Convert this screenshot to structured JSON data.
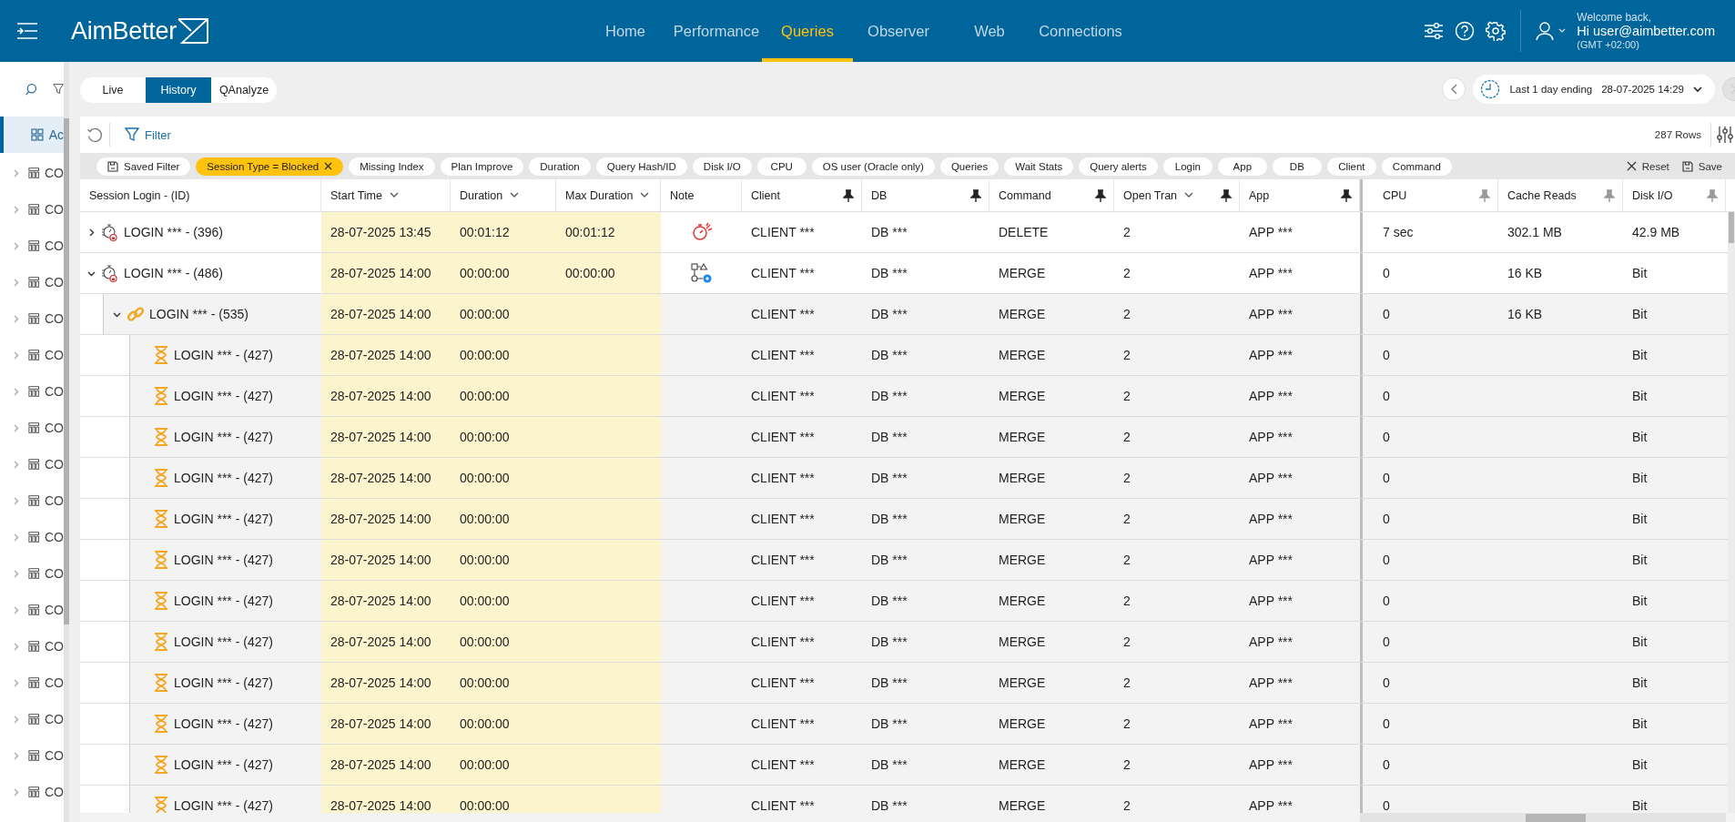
{
  "header": {
    "logo": "AimBetter",
    "nav": [
      {
        "label": "Home",
        "selected": false
      },
      {
        "label": "Performance",
        "selected": false
      },
      {
        "label": "Queries",
        "selected": true
      },
      {
        "label": "Observer",
        "selected": false
      },
      {
        "label": "Web",
        "selected": false
      },
      {
        "label": "Connections",
        "selected": false
      }
    ],
    "user": {
      "greeting": "Welcome back,",
      "name": "Hi user@aimbetter.com",
      "timezone": "(GMT +02:00)"
    }
  },
  "sidebar": {
    "items": [
      {
        "label": "Ac",
        "kind": "dashboard",
        "selected": true
      },
      {
        "label": "CO",
        "kind": "table",
        "selected": false,
        "expanded": false
      },
      {
        "label": "CO",
        "kind": "table",
        "selected": false,
        "expanded": false
      },
      {
        "label": "CO",
        "kind": "table",
        "selected": false,
        "expanded": false
      },
      {
        "label": "CO",
        "kind": "table",
        "selected": false,
        "expanded": false
      },
      {
        "label": "CO",
        "kind": "table",
        "selected": false,
        "expanded": false
      },
      {
        "label": "CO",
        "kind": "table",
        "selected": false,
        "expanded": false
      },
      {
        "label": "CO",
        "kind": "table",
        "selected": false,
        "expanded": false
      },
      {
        "label": "CO",
        "kind": "table",
        "selected": false,
        "expanded": false
      },
      {
        "label": "CO",
        "kind": "table",
        "selected": false,
        "expanded": false
      },
      {
        "label": "CO",
        "kind": "table",
        "selected": false,
        "expanded": false
      },
      {
        "label": "CO",
        "kind": "table",
        "selected": false,
        "expanded": false
      },
      {
        "label": "CO",
        "kind": "table",
        "selected": false,
        "expanded": false
      },
      {
        "label": "CO",
        "kind": "table",
        "selected": false,
        "expanded": false
      },
      {
        "label": "CO",
        "kind": "table",
        "selected": false,
        "expanded": false
      },
      {
        "label": "CO",
        "kind": "table",
        "selected": false,
        "expanded": false
      },
      {
        "label": "CO",
        "kind": "table",
        "selected": false,
        "expanded": false
      },
      {
        "label": "CO",
        "kind": "table",
        "selected": false,
        "expanded": false
      },
      {
        "label": "CO",
        "kind": "table",
        "selected": false,
        "expanded": false
      }
    ]
  },
  "mode_tabs": [
    {
      "label": "Live",
      "selected": false
    },
    {
      "label": "History",
      "selected": true
    },
    {
      "label": "QAnalyze",
      "selected": false
    }
  ],
  "time_range": {
    "label": "Last 1 day ending",
    "value": "28-07-2025 14:29",
    "next_disabled": true
  },
  "toolbar": {
    "filter": "Filter",
    "row_count": "287 Rows"
  },
  "chips": [
    {
      "label": "Saved Filter",
      "kind": "saved"
    },
    {
      "label": "Session Type = Blocked",
      "kind": "active"
    },
    {
      "label": "Missing Index",
      "kind": "plain"
    },
    {
      "label": "Plan Improve",
      "kind": "plain"
    },
    {
      "label": "Duration",
      "kind": "plain"
    },
    {
      "label": "Query Hash/ID",
      "kind": "plain"
    },
    {
      "label": "Disk I/O",
      "kind": "plain"
    },
    {
      "label": "CPU",
      "kind": "plain"
    },
    {
      "label": "OS user (Oracle only)",
      "kind": "plain"
    },
    {
      "label": "Queries",
      "kind": "plain"
    },
    {
      "label": "Wait Stats",
      "kind": "plain"
    },
    {
      "label": "Query alerts",
      "kind": "plain"
    },
    {
      "label": "Login",
      "kind": "plain"
    },
    {
      "label": "App",
      "kind": "plain"
    },
    {
      "label": "DB",
      "kind": "plain"
    },
    {
      "label": "Client",
      "kind": "plain"
    },
    {
      "label": "Command",
      "kind": "plain"
    }
  ],
  "chip_actions": [
    {
      "label": "Reset",
      "kind": "reset"
    },
    {
      "label": "Save",
      "kind": "save"
    }
  ],
  "table": {
    "columns": [
      {
        "label": "Session Login - (ID)",
        "sortable": false
      },
      {
        "label": "Start Time",
        "sortable": true
      },
      {
        "label": "Duration",
        "sortable": true
      },
      {
        "label": "Max Duration",
        "sortable": true
      },
      {
        "label": "Note",
        "sortable": false
      },
      {
        "label": "Client",
        "sortable": false,
        "pinned": true
      },
      {
        "label": "DB",
        "sortable": false,
        "pinned": true
      },
      {
        "label": "Command",
        "sortable": false,
        "pinned": true
      },
      {
        "label": "Open Tran",
        "sortable": true,
        "pinned": true
      },
      {
        "label": "App",
        "sortable": false,
        "pinned": true
      },
      {
        "label": "CPU",
        "sortable": false,
        "pinned": false
      },
      {
        "label": "Cache Reads",
        "sortable": false,
        "pinned": false
      },
      {
        "label": "Disk I/O",
        "sortable": false,
        "pinned": false
      }
    ],
    "rows": [
      {
        "kind": "blocker",
        "expanded": false,
        "login": "LOGIN *** - (396)",
        "start_time": "28-07-2025 13:45",
        "duration": "00:01:12",
        "max_duration": "00:01:12",
        "note": {
          "kind": "alert"
        },
        "client": "CLIENT ***",
        "db": "DB ***",
        "command": "DELETE",
        "open_tran": "2",
        "app": "APP ***",
        "cpu": "7 sec",
        "cache_reads": "302.1 MB",
        "disk_io": "42.9 MB"
      },
      {
        "kind": "blocker",
        "expanded": true,
        "login": "LOGIN *** - (486)",
        "start_time": "28-07-2025 14:00",
        "duration": "00:00:00",
        "max_duration": "00:00:00",
        "note": {
          "kind": "plan"
        },
        "client": "CLIENT ***",
        "db": "DB ***",
        "command": "MERGE",
        "open_tran": "2",
        "app": "APP ***",
        "cpu": "0",
        "cache_reads": "16 KB",
        "disk_io": "Bit",
        "children": [
          {
            "kind": "blocked",
            "expanded": true,
            "login": "LOGIN *** - (535)",
            "start_time": "28-07-2025 14:00",
            "duration": "00:00:00",
            "client": "CLIENT ***",
            "db": "DB ***",
            "command": "MERGE",
            "open_tran": "2",
            "app": "APP ***",
            "cpu": "0",
            "cache_reads": "16 KB",
            "disk_io": "Bit",
            "children": [
              {
                "kind": "waiting",
                "login": "LOGIN *** - (427)",
                "start_time": "28-07-2025 14:00",
                "duration": "00:00:00",
                "client": "CLIENT ***",
                "db": "DB ***",
                "command": "MERGE",
                "open_tran": "2",
                "app": "APP ***",
                "cpu": "0",
                "disk_io": "Bit"
              },
              {
                "kind": "waiting",
                "login": "LOGIN *** - (427)",
                "start_time": "28-07-2025 14:00",
                "duration": "00:00:00",
                "client": "CLIENT ***",
                "db": "DB ***",
                "command": "MERGE",
                "open_tran": "2",
                "app": "APP ***",
                "cpu": "0",
                "disk_io": "Bit"
              },
              {
                "kind": "waiting",
                "login": "LOGIN *** - (427)",
                "start_time": "28-07-2025 14:00",
                "duration": "00:00:00",
                "client": "CLIENT ***",
                "db": "DB ***",
                "command": "MERGE",
                "open_tran": "2",
                "app": "APP ***",
                "cpu": "0",
                "disk_io": "Bit"
              },
              {
                "kind": "waiting",
                "login": "LOGIN *** - (427)",
                "start_time": "28-07-2025 14:00",
                "duration": "00:00:00",
                "client": "CLIENT ***",
                "db": "DB ***",
                "command": "MERGE",
                "open_tran": "2",
                "app": "APP ***",
                "cpu": "0",
                "disk_io": "Bit"
              },
              {
                "kind": "waiting",
                "login": "LOGIN *** - (427)",
                "start_time": "28-07-2025 14:00",
                "duration": "00:00:00",
                "client": "CLIENT ***",
                "db": "DB ***",
                "command": "MERGE",
                "open_tran": "2",
                "app": "APP ***",
                "cpu": "0",
                "disk_io": "Bit"
              },
              {
                "kind": "waiting",
                "login": "LOGIN *** - (427)",
                "start_time": "28-07-2025 14:00",
                "duration": "00:00:00",
                "client": "CLIENT ***",
                "db": "DB ***",
                "command": "MERGE",
                "open_tran": "2",
                "app": "APP ***",
                "cpu": "0",
                "disk_io": "Bit"
              },
              {
                "kind": "waiting",
                "login": "LOGIN *** - (427)",
                "start_time": "28-07-2025 14:00",
                "duration": "00:00:00",
                "client": "CLIENT ***",
                "db": "DB ***",
                "command": "MERGE",
                "open_tran": "2",
                "app": "APP ***",
                "cpu": "0",
                "disk_io": "Bit"
              },
              {
                "kind": "waiting",
                "login": "LOGIN *** - (427)",
                "start_time": "28-07-2025 14:00",
                "duration": "00:00:00",
                "client": "CLIENT ***",
                "db": "DB ***",
                "command": "MERGE",
                "open_tran": "2",
                "app": "APP ***",
                "cpu": "0",
                "disk_io": "Bit"
              },
              {
                "kind": "waiting",
                "login": "LOGIN *** - (427)",
                "start_time": "28-07-2025 14:00",
                "duration": "00:00:00",
                "client": "CLIENT ***",
                "db": "DB ***",
                "command": "MERGE",
                "open_tran": "2",
                "app": "APP ***",
                "cpu": "0",
                "disk_io": "Bit"
              },
              {
                "kind": "waiting",
                "login": "LOGIN *** - (427)",
                "start_time": "28-07-2025 14:00",
                "duration": "00:00:00",
                "client": "CLIENT ***",
                "db": "DB ***",
                "command": "MERGE",
                "open_tran": "2",
                "app": "APP ***",
                "cpu": "0",
                "disk_io": "Bit"
              },
              {
                "kind": "waiting",
                "login": "LOGIN *** - (427)",
                "start_time": "28-07-2025 14:00",
                "duration": "00:00:00",
                "client": "CLIENT ***",
                "db": "DB ***",
                "command": "MERGE",
                "open_tran": "2",
                "app": "APP ***",
                "cpu": "0",
                "disk_io": "Bit"
              },
              {
                "kind": "waiting",
                "login": "LOGIN *** - (427)",
                "start_time": "28-07-2025 14:00",
                "duration": "00:00:00",
                "client": "CLIENT ***",
                "db": "DB ***",
                "command": "MERGE",
                "open_tran": "2",
                "app": "APP ***",
                "cpu": "0",
                "disk_io": "Bit"
              }
            ]
          }
        ]
      }
    ]
  }
}
